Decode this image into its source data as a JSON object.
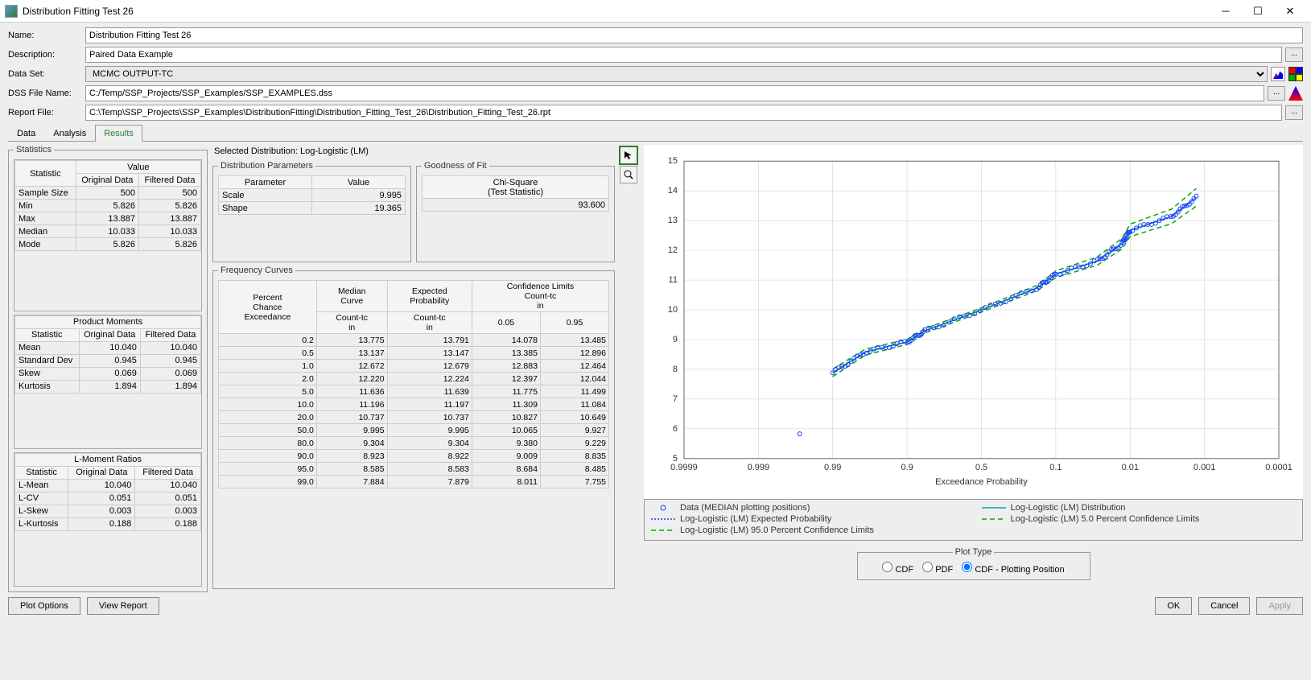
{
  "window": {
    "title": "Distribution Fitting Test 26"
  },
  "header": {
    "name_label": "Name:",
    "name_value": "Distribution Fitting Test 26",
    "desc_label": "Description:",
    "desc_value": "Paired Data Example",
    "dataset_label": "Data Set:",
    "dataset_value": "MCMC OUTPUT-TC",
    "dssfile_label": "DSS File Name:",
    "dssfile_value": "C:/Temp/SSP_Projects/SSP_Examples/SSP_EXAMPLES.dss",
    "report_label": "Report File:",
    "report_value": "C:\\Temp\\SSP_Projects\\SSP_Examples\\DistributionFitting\\Distribution_Fitting_Test_26\\Distribution_Fitting_Test_26.rpt"
  },
  "tabs": {
    "data": "Data",
    "analysis": "Analysis",
    "results": "Results"
  },
  "statistics": {
    "legend": "Statistics",
    "hdr_stat": "Statistic",
    "hdr_value": "Value",
    "hdr_orig": "Original Data",
    "hdr_filt": "Filtered Data",
    "rows": [
      {
        "s": "Sample Size",
        "o": "500",
        "f": "500"
      },
      {
        "s": "Min",
        "o": "5.826",
        "f": "5.826"
      },
      {
        "s": "Max",
        "o": "13.887",
        "f": "13.887"
      },
      {
        "s": "Median",
        "o": "10.033",
        "f": "10.033"
      },
      {
        "s": "Mode",
        "o": "5.826",
        "f": "5.826"
      }
    ],
    "pm_legend": "Product Moments",
    "pm_rows": [
      {
        "s": "Mean",
        "o": "10.040",
        "f": "10.040"
      },
      {
        "s": "Standard Dev",
        "o": "0.945",
        "f": "0.945"
      },
      {
        "s": "Skew",
        "o": "0.069",
        "f": "0.069"
      },
      {
        "s": "Kurtosis",
        "o": "1.894",
        "f": "1.894"
      }
    ],
    "lm_legend": "L-Moment Ratios",
    "lm_rows": [
      {
        "s": "L-Mean",
        "o": "10.040",
        "f": "10.040"
      },
      {
        "s": "L-CV",
        "o": "0.051",
        "f": "0.051"
      },
      {
        "s": "L-Skew",
        "o": "0.003",
        "f": "0.003"
      },
      {
        "s": "L-Kurtosis",
        "o": "0.188",
        "f": "0.188"
      }
    ]
  },
  "selected_dist": {
    "label": "Selected Distribution: Log-Logistic (LM)",
    "params_legend": "Distribution Parameters",
    "param_hdr": "Parameter",
    "value_hdr": "Value",
    "params": [
      {
        "p": "Scale",
        "v": "9.995"
      },
      {
        "p": "Shape",
        "v": "19.365"
      }
    ],
    "gof_legend": "Goodness of Fit",
    "gof_hdr": "Chi-Square\n(Test Statistic)",
    "gof_hdr_l1": "Chi-Square",
    "gof_hdr_l2": "(Test Statistic)",
    "gof_val": "93.600"
  },
  "freq": {
    "legend": "Frequency Curves",
    "hdr": {
      "pce_l1": "Percent",
      "pce_l2": "Chance",
      "pce_l3": "Exceedance",
      "median_l1": "Median",
      "median_l2": "Curve",
      "exp_l1": "Expected",
      "exp_l2": "Probability",
      "conf_l1": "Confidence Limits",
      "conf_l2": "Count-tc",
      "conf_l3": "in",
      "count_l1": "Count-tc",
      "count_l2": "in",
      "c05": "0.05",
      "c95": "0.95"
    },
    "rows": [
      {
        "p": "0.2",
        "m": "13.775",
        "e": "13.791",
        "c5": "14.078",
        "c95": "13.485"
      },
      {
        "p": "0.5",
        "m": "13.137",
        "e": "13.147",
        "c5": "13.385",
        "c95": "12.896"
      },
      {
        "p": "1.0",
        "m": "12.672",
        "e": "12.679",
        "c5": "12.883",
        "c95": "12.464"
      },
      {
        "p": "2.0",
        "m": "12.220",
        "e": "12.224",
        "c5": "12.397",
        "c95": "12.044"
      },
      {
        "p": "5.0",
        "m": "11.636",
        "e": "11.639",
        "c5": "11.775",
        "c95": "11.499"
      },
      {
        "p": "10.0",
        "m": "11.196",
        "e": "11.197",
        "c5": "11.309",
        "c95": "11.084"
      },
      {
        "p": "20.0",
        "m": "10.737",
        "e": "10.737",
        "c5": "10.827",
        "c95": "10.649"
      },
      {
        "p": "50.0",
        "m": "9.995",
        "e": "9.995",
        "c5": "10.065",
        "c95": "9.927"
      },
      {
        "p": "80.0",
        "m": "9.304",
        "e": "9.304",
        "c5": "9.380",
        "c95": "9.229"
      },
      {
        "p": "90.0",
        "m": "8.923",
        "e": "8.922",
        "c5": "9.009",
        "c95": "8.835"
      },
      {
        "p": "95.0",
        "m": "8.585",
        "e": "8.583",
        "c5": "8.684",
        "c95": "8.485"
      },
      {
        "p": "99.0",
        "m": "7.884",
        "e": "7.879",
        "c5": "8.011",
        "c95": "7.755"
      }
    ]
  },
  "chart_legend": {
    "l1": "Data (MEDIAN plotting positions)",
    "l2": "Log-Logistic (LM) Distribution",
    "l3": "Log-Logistic (LM) Expected Probability",
    "l4": "Log-Logistic (LM) 5.0 Percent Confidence Limits",
    "l5": "Log-Logistic (LM) 95.0 Percent Confidence Limits"
  },
  "chart_data": {
    "type": "line",
    "xlabel": "Exceedance Probability",
    "ylabel": "",
    "ylim": [
      5,
      15
    ],
    "y_ticks": [
      5,
      6,
      7,
      8,
      9,
      10,
      11,
      12,
      13,
      14,
      15
    ],
    "x_ticks": [
      "0.9999",
      "0.999",
      "0.99",
      "0.9",
      "0.5",
      "0.1",
      "0.01",
      "0.001",
      "0.0001"
    ],
    "series": [
      {
        "name": "Log-Logistic (LM) Distribution",
        "x": [
          99,
          95,
          90,
          80,
          50,
          20,
          10,
          5,
          2,
          1,
          0.5,
          0.2
        ],
        "y": [
          7.884,
          8.585,
          8.923,
          9.304,
          9.995,
          10.737,
          11.196,
          11.636,
          12.22,
          12.672,
          13.137,
          13.775
        ]
      },
      {
        "name": "Log-Logistic (LM) Expected Probability",
        "x": [
          99,
          95,
          90,
          80,
          50,
          20,
          10,
          5,
          2,
          1,
          0.5,
          0.2
        ],
        "y": [
          7.879,
          8.583,
          8.922,
          9.304,
          9.995,
          10.737,
          11.197,
          11.639,
          12.224,
          12.679,
          13.147,
          13.791
        ]
      },
      {
        "name": "Log-Logistic (LM) 5.0 Percent Confidence Limits",
        "x": [
          99,
          95,
          90,
          80,
          50,
          20,
          10,
          5,
          2,
          1,
          0.5,
          0.2
        ],
        "y": [
          8.011,
          8.684,
          9.009,
          9.38,
          10.065,
          10.827,
          11.309,
          11.775,
          12.397,
          12.883,
          13.385,
          14.078
        ]
      },
      {
        "name": "Log-Logistic (LM) 95.0 Percent Confidence Limits",
        "x": [
          99,
          95,
          90,
          80,
          50,
          20,
          10,
          5,
          2,
          1,
          0.5,
          0.2
        ],
        "y": [
          7.755,
          8.485,
          8.835,
          9.229,
          9.927,
          10.649,
          11.084,
          11.499,
          12.044,
          12.464,
          12.896,
          13.485
        ]
      }
    ],
    "data_points_note": "Data series: 500 points following the median curve, approx range y=[5.826,13.887]"
  },
  "plot_type": {
    "legend": "Plot Type",
    "cdf": "CDF",
    "pdf": "PDF",
    "cdfpp": "CDF - Plotting Position",
    "selected": "cdfpp"
  },
  "buttons": {
    "plot_options": "Plot Options",
    "view_report": "View Report",
    "ok": "OK",
    "cancel": "Cancel",
    "apply": "Apply"
  }
}
